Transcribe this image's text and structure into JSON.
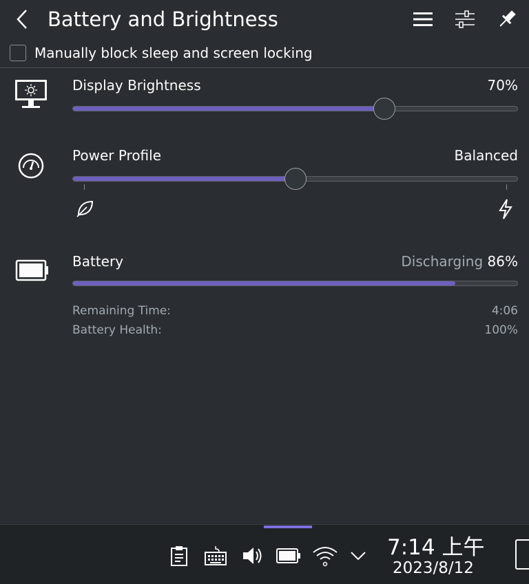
{
  "header": {
    "title": "Battery and Brightness"
  },
  "inhibit": {
    "label": "Manually block sleep and screen locking",
    "checked": false
  },
  "brightness": {
    "label": "Display Brightness",
    "value_text": "70%",
    "level": 0.7
  },
  "power_profile": {
    "label": "Power Profile",
    "value_text": "Balanced",
    "level": 0.5
  },
  "battery": {
    "label": "Battery",
    "state": "Discharging",
    "percent_text": "86%",
    "level": 0.86,
    "remaining_label": "Remaining Time:",
    "remaining_value": "4:06",
    "health_label": "Battery Health:",
    "health_value": "100%"
  },
  "taskbar": {
    "time": "7:14 上午",
    "date": "2023/8/12"
  },
  "colors": {
    "background": "#2a2e32",
    "accent": "#6d5fbf",
    "text": "#fcfcfc",
    "muted": "#a1a9b1"
  }
}
